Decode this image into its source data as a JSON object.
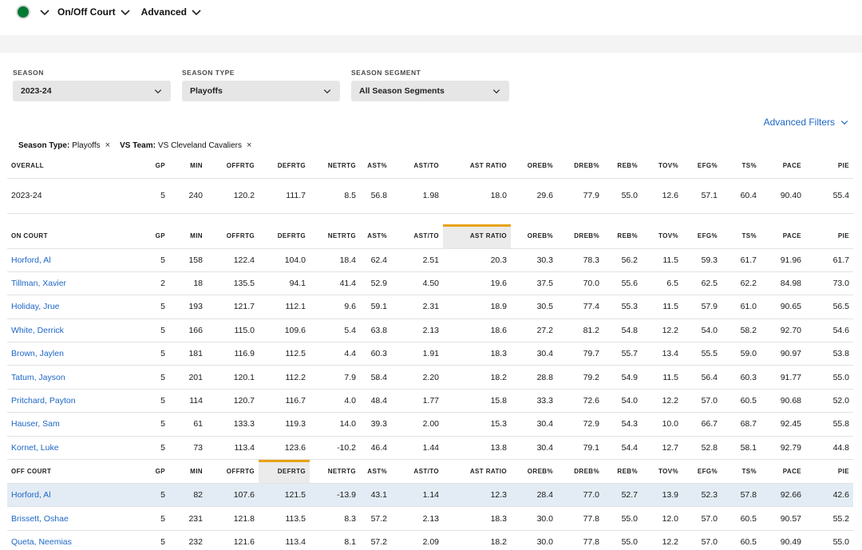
{
  "nav": {
    "items": [
      {
        "label": "On/Off Court"
      },
      {
        "label": "Advanced"
      }
    ]
  },
  "filters": [
    {
      "label": "SEASON",
      "value": "2023-24"
    },
    {
      "label": "SEASON TYPE",
      "value": "Playoffs"
    },
    {
      "label": "SEASON SEGMENT",
      "value": "All Season Segments"
    }
  ],
  "advanced_filters_label": "Advanced Filters",
  "chips": [
    {
      "key": "Season Type:",
      "value": "Playoffs",
      "close": "×"
    },
    {
      "key": "VS Team:",
      "value": "VS Cleveland Cavaliers",
      "close": "×"
    }
  ],
  "columns": [
    "GP",
    "MIN",
    "OFFRTG",
    "DEFRTG",
    "NETRTG",
    "AST%",
    "AST/TO",
    "AST RATIO",
    "OREB%",
    "DREB%",
    "REB%",
    "TOV%",
    "EFG%",
    "TS%",
    "PACE",
    "PIE"
  ],
  "sections": {
    "overall": {
      "title": "OVERALL",
      "rows": [
        {
          "name": "2023-24",
          "values": [
            "5",
            "240",
            "120.2",
            "111.7",
            "8.5",
            "56.8",
            "1.98",
            "18.0",
            "29.6",
            "77.9",
            "55.0",
            "12.6",
            "57.1",
            "60.4",
            "90.40",
            "55.4"
          ]
        }
      ]
    },
    "on_court": {
      "title": "ON COURT",
      "rows": [
        {
          "name": "Horford, Al",
          "values": [
            "5",
            "158",
            "122.4",
            "104.0",
            "18.4",
            "62.4",
            "2.51",
            "20.3",
            "30.3",
            "78.3",
            "56.2",
            "11.5",
            "59.3",
            "61.7",
            "91.96",
            "61.7"
          ]
        },
        {
          "name": "Tillman, Xavier",
          "values": [
            "2",
            "18",
            "135.5",
            "94.1",
            "41.4",
            "52.9",
            "4.50",
            "19.6",
            "37.5",
            "70.0",
            "55.6",
            "6.5",
            "62.5",
            "62.2",
            "84.98",
            "73.0"
          ]
        },
        {
          "name": "Holiday, Jrue",
          "values": [
            "5",
            "193",
            "121.7",
            "112.1",
            "9.6",
            "59.1",
            "2.31",
            "18.9",
            "30.5",
            "77.4",
            "55.3",
            "11.5",
            "57.9",
            "61.0",
            "90.65",
            "56.5"
          ]
        },
        {
          "name": "White, Derrick",
          "values": [
            "5",
            "166",
            "115.0",
            "109.6",
            "5.4",
            "63.8",
            "2.13",
            "18.6",
            "27.2",
            "81.2",
            "54.8",
            "12.2",
            "54.0",
            "58.2",
            "92.70",
            "54.6"
          ]
        },
        {
          "name": "Brown, Jaylen",
          "values": [
            "5",
            "181",
            "116.9",
            "112.5",
            "4.4",
            "60.3",
            "1.91",
            "18.3",
            "30.4",
            "79.7",
            "55.7",
            "13.4",
            "55.5",
            "59.0",
            "90.97",
            "53.8"
          ]
        },
        {
          "name": "Tatum, Jayson",
          "values": [
            "5",
            "201",
            "120.1",
            "112.2",
            "7.9",
            "58.4",
            "2.20",
            "18.2",
            "28.8",
            "79.2",
            "54.9",
            "11.5",
            "56.4",
            "60.3",
            "91.77",
            "55.0"
          ]
        },
        {
          "name": "Pritchard, Payton",
          "values": [
            "5",
            "114",
            "120.7",
            "116.7",
            "4.0",
            "48.4",
            "1.77",
            "15.8",
            "33.3",
            "72.6",
            "54.0",
            "12.2",
            "57.0",
            "60.5",
            "90.68",
            "52.0"
          ]
        },
        {
          "name": "Hauser, Sam",
          "values": [
            "5",
            "61",
            "133.3",
            "119.3",
            "14.0",
            "39.3",
            "2.00",
            "15.3",
            "30.4",
            "72.9",
            "54.3",
            "10.0",
            "66.7",
            "68.7",
            "92.45",
            "55.8"
          ]
        },
        {
          "name": "Kornet, Luke",
          "values": [
            "5",
            "73",
            "113.4",
            "123.6",
            "-10.2",
            "46.4",
            "1.44",
            "13.8",
            "30.4",
            "79.1",
            "54.4",
            "12.7",
            "52.8",
            "58.1",
            "92.79",
            "44.8"
          ]
        }
      ]
    },
    "off_court": {
      "title": "OFF COURT",
      "rows": [
        {
          "name": "Horford, Al",
          "values": [
            "5",
            "82",
            "107.6",
            "121.5",
            "-13.9",
            "43.1",
            "1.14",
            "12.3",
            "28.4",
            "77.0",
            "52.7",
            "13.9",
            "52.3",
            "57.8",
            "92.66",
            "42.6"
          ]
        },
        {
          "name": "Brissett, Oshae",
          "values": [
            "5",
            "231",
            "121.8",
            "113.5",
            "8.3",
            "57.2",
            "2.13",
            "18.3",
            "30.0",
            "77.8",
            "55.0",
            "12.0",
            "57.0",
            "60.5",
            "90.57",
            "55.2"
          ]
        },
        {
          "name": "Queta, Neemias",
          "values": [
            "5",
            "232",
            "121.6",
            "113.4",
            "8.1",
            "57.2",
            "2.09",
            "18.2",
            "30.0",
            "77.8",
            "55.0",
            "12.2",
            "57.0",
            "60.5",
            "90.49",
            "55.0"
          ]
        }
      ]
    }
  }
}
